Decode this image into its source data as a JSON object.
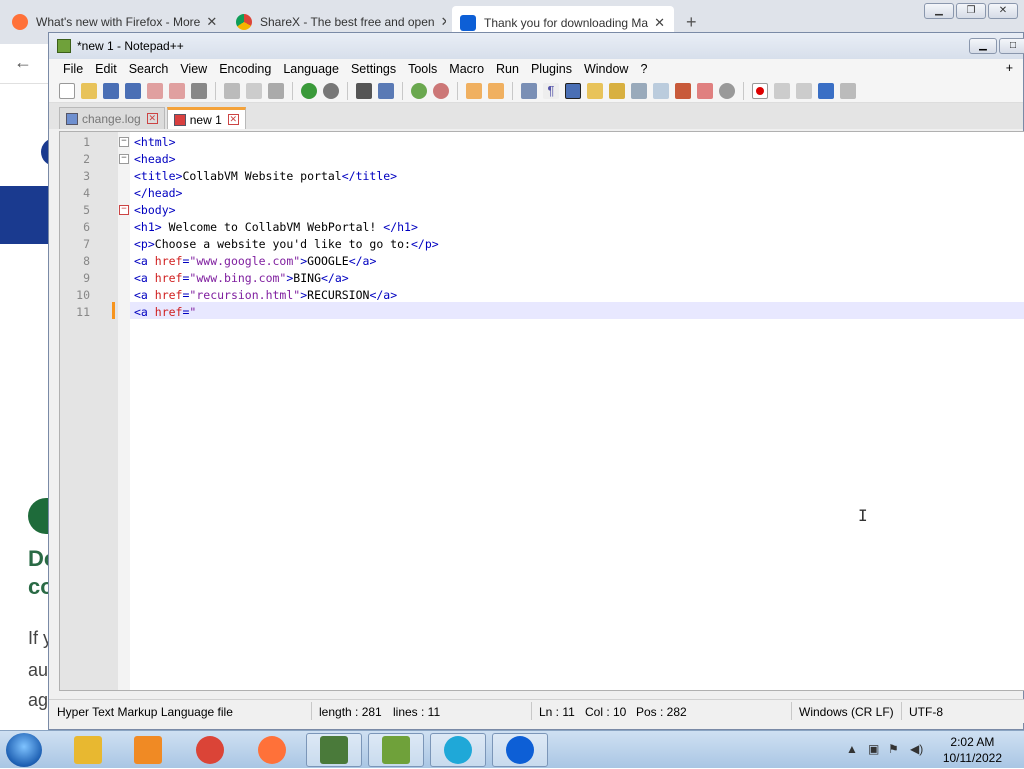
{
  "browser": {
    "tabs": [
      {
        "title": "What's new with Firefox - More",
        "icon": "firefox-icon",
        "color": "#ff7139"
      },
      {
        "title": "ShareX - The best free and open",
        "icon": "chrome-icon",
        "color": "#4285f4"
      },
      {
        "title": "Thank you for downloading Ma",
        "icon": "malwarebytes-icon",
        "color": "#0d5fd6"
      }
    ],
    "background_text": {
      "heading_line1": "Do",
      "heading_line2": "co",
      "para_line1": "If y",
      "para_line2": "au",
      "para_line3": "ag"
    }
  },
  "notepad": {
    "title": "*new 1 - Notepad++",
    "menu": [
      "File",
      "Edit",
      "Search",
      "View",
      "Encoding",
      "Language",
      "Settings",
      "Tools",
      "Macro",
      "Run",
      "Plugins",
      "Window",
      "?"
    ],
    "menu_plus": "+",
    "doc_tabs": [
      {
        "label": "change.log",
        "active": false
      },
      {
        "label": "new 1",
        "active": true
      }
    ],
    "lines": [
      {
        "n": "1",
        "parts": [
          [
            "tag",
            "<html>"
          ]
        ]
      },
      {
        "n": "2",
        "parts": [
          [
            "tag",
            "<head>"
          ]
        ]
      },
      {
        "n": "3",
        "parts": [
          [
            "tag",
            "<title>"
          ],
          [
            "text",
            "CollabVM Website portal"
          ],
          [
            "tag",
            "</title>"
          ]
        ]
      },
      {
        "n": "4",
        "parts": [
          [
            "tag",
            "</head>"
          ]
        ]
      },
      {
        "n": "5",
        "parts": [
          [
            "tag",
            "<body>"
          ]
        ]
      },
      {
        "n": "6",
        "parts": [
          [
            "tag",
            "<h1>"
          ],
          [
            "text",
            " Welcome to CollabVM WebPortal! "
          ],
          [
            "tag",
            "</h1>"
          ]
        ]
      },
      {
        "n": "7",
        "parts": [
          [
            "tag",
            "<p>"
          ],
          [
            "text",
            "Choose a website you'd like to go to:"
          ],
          [
            "tag",
            "</p>"
          ]
        ]
      },
      {
        "n": "8",
        "parts": [
          [
            "tag",
            "<a "
          ],
          [
            "attr",
            "href"
          ],
          [
            "tag",
            "="
          ],
          [
            "val",
            "\"www.google.com\""
          ],
          [
            "tag",
            ">"
          ],
          [
            "text",
            "GOOGLE"
          ],
          [
            "tag",
            "</a>"
          ]
        ]
      },
      {
        "n": "9",
        "parts": [
          [
            "tag",
            "<a "
          ],
          [
            "attr",
            "href"
          ],
          [
            "tag",
            "="
          ],
          [
            "val",
            "\"www.bing.com\""
          ],
          [
            "tag",
            ">"
          ],
          [
            "text",
            "BING"
          ],
          [
            "tag",
            "</a>"
          ]
        ]
      },
      {
        "n": "10",
        "parts": [
          [
            "tag",
            "<a "
          ],
          [
            "attr",
            "href"
          ],
          [
            "tag",
            "="
          ],
          [
            "val",
            "\"recursion.html\""
          ],
          [
            "tag",
            ">"
          ],
          [
            "text",
            "RECURSION"
          ],
          [
            "tag",
            "</a>"
          ]
        ]
      },
      {
        "n": "11",
        "parts": [
          [
            "tag",
            "<a "
          ],
          [
            "attr",
            "href"
          ],
          [
            "tag",
            "="
          ],
          [
            "val",
            "\""
          ]
        ]
      }
    ],
    "status": {
      "filetype": "Hyper Text Markup Language file",
      "length": "length : 281",
      "lines": "lines : 11",
      "ln": "Ln : 11",
      "col": "Col : 10",
      "pos": "Pos : 282",
      "eol": "Windows (CR LF)",
      "encoding": "UTF-8"
    }
  },
  "taskbar": {
    "apps": [
      {
        "name": "file-explorer-icon",
        "color": "#e8b830"
      },
      {
        "name": "media-player-icon",
        "color": "#f08a24"
      },
      {
        "name": "chrome-icon",
        "color": "#db4437"
      },
      {
        "name": "firefox-icon",
        "color": "#ff7139"
      },
      {
        "name": "vm-monitor-icon",
        "color": "#4a7a3a"
      },
      {
        "name": "notepadpp-icon",
        "color": "#6fa13a"
      },
      {
        "name": "edge-icon",
        "color": "#1fa8d8"
      },
      {
        "name": "malwarebytes-icon",
        "color": "#0d5fd6"
      }
    ],
    "time": "2:02 AM",
    "date": "10/11/2022"
  }
}
